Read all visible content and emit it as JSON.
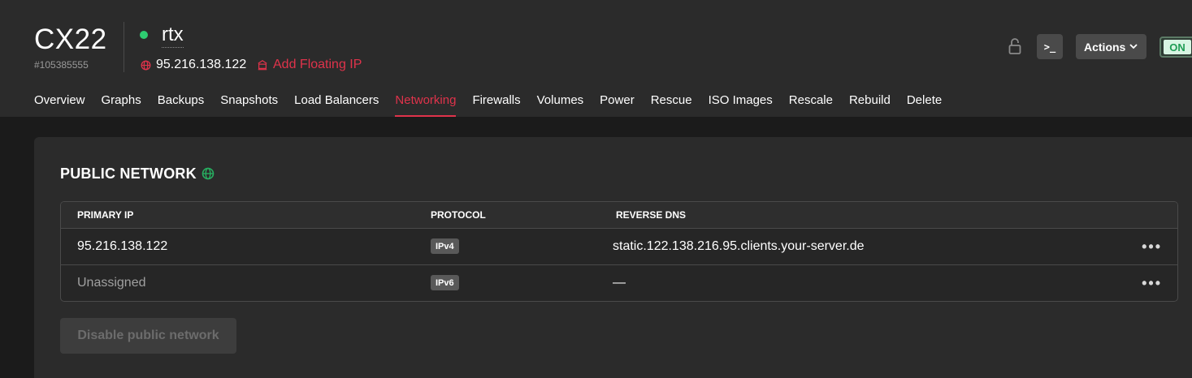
{
  "server": {
    "type": "CX22",
    "id": "#105385555",
    "name": "rtx",
    "status_color": "#2ecc71",
    "ip": "95.216.138.122",
    "add_floating_ip_label": "Add Floating IP"
  },
  "header_actions": {
    "lock_icon": "lock-icon",
    "console_label": ">_",
    "actions_label": "Actions",
    "power_toggle_label": "ON"
  },
  "tabs": [
    {
      "label": "Overview",
      "active": false
    },
    {
      "label": "Graphs",
      "active": false
    },
    {
      "label": "Backups",
      "active": false
    },
    {
      "label": "Snapshots",
      "active": false
    },
    {
      "label": "Load Balancers",
      "active": false
    },
    {
      "label": "Networking",
      "active": true
    },
    {
      "label": "Firewalls",
      "active": false
    },
    {
      "label": "Volumes",
      "active": false
    },
    {
      "label": "Power",
      "active": false
    },
    {
      "label": "Rescue",
      "active": false
    },
    {
      "label": "ISO Images",
      "active": false
    },
    {
      "label": "Rescale",
      "active": false
    },
    {
      "label": "Rebuild",
      "active": false
    },
    {
      "label": "Delete",
      "active": false
    }
  ],
  "public_network": {
    "title": "PUBLIC NETWORK",
    "columns": [
      "PRIMARY IP",
      "PROTOCOL",
      "REVERSE DNS"
    ],
    "rows": [
      {
        "ip": "95.216.138.122",
        "protocol": "IPv4",
        "reverse_dns": "static.122.138.216.95.clients.your-server.de",
        "menu": "•••"
      },
      {
        "ip": "Unassigned",
        "protocol": "IPv6",
        "reverse_dns": "—",
        "menu": "•••"
      }
    ],
    "disable_button_label": "Disable public network"
  },
  "colors": {
    "accent": "#e0334b",
    "status_online": "#2ecc71",
    "globe_green": "#27ae60"
  }
}
